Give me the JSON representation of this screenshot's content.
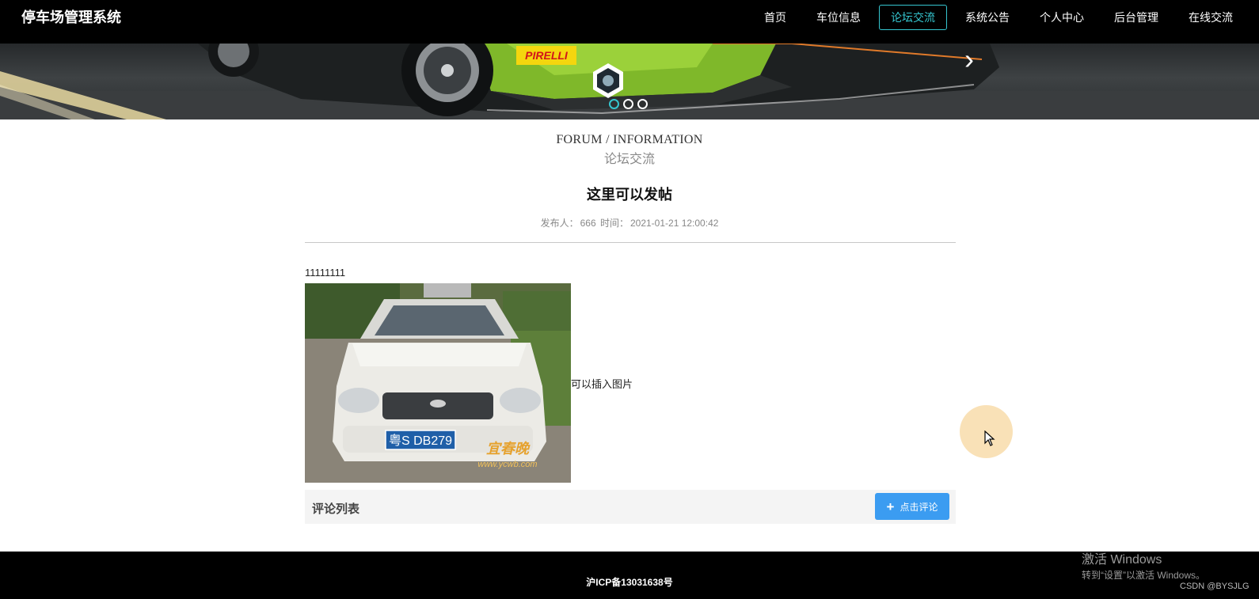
{
  "header": {
    "brand": "停车场管理系统",
    "nav": [
      {
        "label": "首页",
        "active": false
      },
      {
        "label": "车位信息",
        "active": false
      },
      {
        "label": "论坛交流",
        "active": true
      },
      {
        "label": "系统公告",
        "active": false
      },
      {
        "label": "个人中心",
        "active": false
      },
      {
        "label": "后台管理",
        "active": false
      },
      {
        "label": "在线交流",
        "active": false
      }
    ]
  },
  "banner": {
    "brand_text": "PIRELLI",
    "next_icon": "chevron-right-icon",
    "slides_total": 3,
    "active_slide": 1
  },
  "section": {
    "title_en": "FORUM / INFORMATION",
    "title_cn": "论坛交流"
  },
  "post": {
    "title": "这里可以发帖",
    "author_label": "发布人：",
    "author": "666",
    "time_label": "时间：",
    "time": "2021-01-21 12:00:42",
    "body_text": "11111111",
    "image_caption": "可以插入图片",
    "photo": {
      "plate": "粤S DB279",
      "watermark_line1": "宜春晚",
      "watermark_line2": "www.ycwb.com"
    }
  },
  "comments": {
    "title": "评论列表",
    "button_label": "点击评论",
    "button_icon": "plus-icon"
  },
  "footer": {
    "icp": "沪ICP备13031638号"
  },
  "overlay": {
    "windows_activate_title": "激活 Windows",
    "windows_activate_sub": "转到“设置”以激活 Windows。",
    "watermark": "CSDN @BYSJLG"
  },
  "colors": {
    "accent": "#35c6d0",
    "button": "#3b9cf1",
    "cursor_halo": "#f6d69b",
    "topbar": "#000000"
  }
}
